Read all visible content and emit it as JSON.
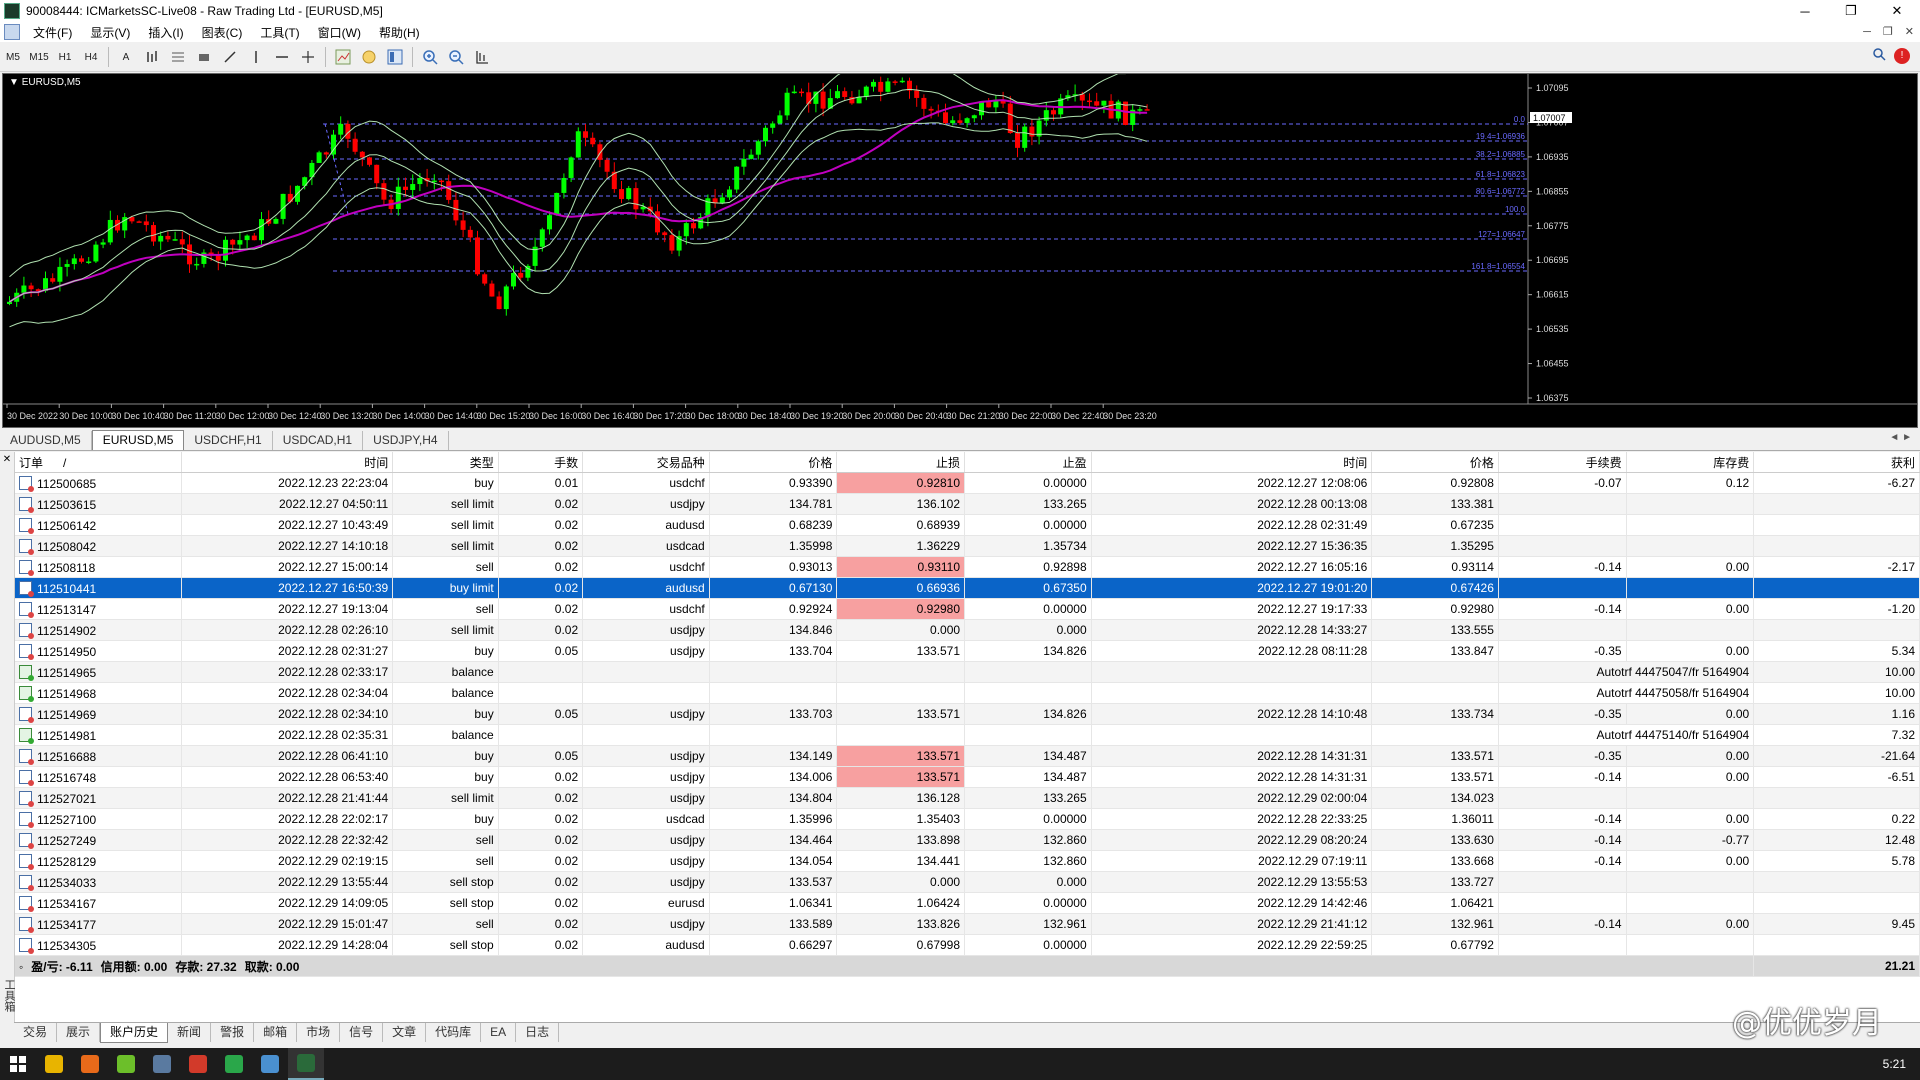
{
  "window": {
    "title": "90008444: ICMarketsSC-Live08 - Raw Trading Ltd - [EURUSD,M5]"
  },
  "menu": [
    "文件(F)",
    "显示(V)",
    "插入(I)",
    "图表(C)",
    "工具(T)",
    "窗口(W)",
    "帮助(H)"
  ],
  "toolbar": {
    "timeframes": [
      "M5",
      "M15",
      "H1",
      "H4"
    ],
    "tools": [
      "A"
    ]
  },
  "chart": {
    "label": "EURUSD,M5",
    "background": "#000000",
    "bull_color": "#00ff00",
    "bear_color": "#ff0000",
    "ma_color": "#c000c0",
    "fib_color": "#6a6aff",
    "price_labels": [
      "1.07095",
      "1.07007",
      "1.06935",
      "1.06855",
      "1.06775",
      "1.06695",
      "1.06615",
      "1.06535",
      "1.06455",
      "1.06375"
    ],
    "current_price": "1.07007",
    "fib_labels": [
      "0.0",
      "19.4=1.06936",
      "38.2=1.06885",
      "61.8=1.06823",
      "80.6=1.06772",
      "100.0",
      "127=1.06647",
      "161.8=1.06554"
    ],
    "time_labels": [
      "30 Dec 2022",
      "30 Dec 10:00",
      "30 Dec 10:40",
      "30 Dec 11:20",
      "30 Dec 12:00",
      "30 Dec 12:40",
      "30 Dec 13:20",
      "30 Dec 14:00",
      "30 Dec 14:40",
      "30 Dec 15:20",
      "30 Dec 16:00",
      "30 Dec 16:40",
      "30 Dec 17:20",
      "30 Dec 18:00",
      "30 Dec 18:40",
      "30 Dec 19:20",
      "30 Dec 20:00",
      "30 Dec 20:40",
      "30 Dec 21:20",
      "30 Dec 22:00",
      "30 Dec 22:40",
      "30 Dec 23:20"
    ]
  },
  "chart_tabs": [
    "AUDUSD,M5",
    "EURUSD,M5",
    "USDCHF,H1",
    "USDCAD,H1",
    "USDJPY,H4"
  ],
  "active_chart_tab": 1,
  "table": {
    "headers": [
      "订单",
      "时间",
      "类型",
      "手数",
      "交易品种",
      "价格",
      "止损",
      "止盈",
      "时间",
      "价格",
      "手续费",
      "库存费",
      "获利"
    ],
    "sort_marker": "/",
    "rows": [
      {
        "icon": "order",
        "cells": [
          "112500685",
          "2022.12.23 22:23:04",
          "buy",
          "0.01",
          "usdchf",
          "0.93390",
          "0.92810",
          "0.00000",
          "2022.12.27 12:08:06",
          "0.92808",
          "-0.07",
          "0.12",
          "-6.27"
        ],
        "sl_hit": true
      },
      {
        "icon": "order",
        "cells": [
          "112503615",
          "2022.12.27 04:50:11",
          "sell limit",
          "0.02",
          "usdjpy",
          "134.781",
          "136.102",
          "133.265",
          "2022.12.28 00:13:08",
          "133.381",
          "",
          "",
          ""
        ]
      },
      {
        "icon": "order",
        "cells": [
          "112506142",
          "2022.12.27 10:43:49",
          "sell limit",
          "0.02",
          "audusd",
          "0.68239",
          "0.68939",
          "0.00000",
          "2022.12.28 02:31:49",
          "0.67235",
          "",
          "",
          ""
        ]
      },
      {
        "icon": "order",
        "cells": [
          "112508042",
          "2022.12.27 14:10:18",
          "sell limit",
          "0.02",
          "usdcad",
          "1.35998",
          "1.36229",
          "1.35734",
          "2022.12.27 15:36:35",
          "1.35295",
          "",
          "",
          ""
        ]
      },
      {
        "icon": "order",
        "cells": [
          "112508118",
          "2022.12.27 15:00:14",
          "sell",
          "0.02",
          "usdchf",
          "0.93013",
          "0.93110",
          "0.92898",
          "2022.12.27 16:05:16",
          "0.93114",
          "-0.14",
          "0.00",
          "-2.17"
        ],
        "sl_hit": true
      },
      {
        "icon": "order",
        "cells": [
          "112510441",
          "2022.12.27 16:50:39",
          "buy limit",
          "0.02",
          "audusd",
          "0.67130",
          "0.66936",
          "0.67350",
          "2022.12.27 19:01:20",
          "0.67426",
          "",
          "",
          ""
        ],
        "selected": true
      },
      {
        "icon": "order",
        "cells": [
          "112513147",
          "2022.12.27 19:13:04",
          "sell",
          "0.02",
          "usdchf",
          "0.92924",
          "0.92980",
          "0.00000",
          "2022.12.27 19:17:33",
          "0.92980",
          "-0.14",
          "0.00",
          "-1.20"
        ],
        "sl_hit": true
      },
      {
        "icon": "order",
        "cells": [
          "112514902",
          "2022.12.28 02:26:10",
          "sell limit",
          "0.02",
          "usdjpy",
          "134.846",
          "0.000",
          "0.000",
          "2022.12.28 14:33:27",
          "133.555",
          "",
          "",
          ""
        ]
      },
      {
        "icon": "order",
        "cells": [
          "112514950",
          "2022.12.28 02:31:27",
          "buy",
          "0.05",
          "usdjpy",
          "133.704",
          "133.571",
          "134.826",
          "2022.12.28 08:11:28",
          "133.847",
          "-0.35",
          "0.00",
          "5.34"
        ]
      },
      {
        "icon": "balance",
        "cells": [
          "112514965",
          "2022.12.28 02:33:17",
          "balance",
          "",
          "",
          "",
          "",
          "",
          "",
          "",
          "Autotrf 44475047/fr 5164904",
          "",
          "10.00"
        ],
        "balance": true
      },
      {
        "icon": "balance",
        "cells": [
          "112514968",
          "2022.12.28 02:34:04",
          "balance",
          "",
          "",
          "",
          "",
          "",
          "",
          "",
          "Autotrf 44475058/fr 5164904",
          "",
          "10.00"
        ],
        "balance": true
      },
      {
        "icon": "order",
        "cells": [
          "112514969",
          "2022.12.28 02:34:10",
          "buy",
          "0.05",
          "usdjpy",
          "133.703",
          "133.571",
          "134.826",
          "2022.12.28 14:10:48",
          "133.734",
          "-0.35",
          "0.00",
          "1.16"
        ]
      },
      {
        "icon": "balance",
        "cells": [
          "112514981",
          "2022.12.28 02:35:31",
          "balance",
          "",
          "",
          "",
          "",
          "",
          "",
          "",
          "Autotrf 44475140/fr 5164904",
          "",
          "7.32"
        ],
        "balance": true
      },
      {
        "icon": "order",
        "cells": [
          "112516688",
          "2022.12.28 06:41:10",
          "buy",
          "0.05",
          "usdjpy",
          "134.149",
          "133.571",
          "134.487",
          "2022.12.28 14:31:31",
          "133.571",
          "-0.35",
          "0.00",
          "-21.64"
        ],
        "sl_hit": true
      },
      {
        "icon": "order",
        "cells": [
          "112516748",
          "2022.12.28 06:53:40",
          "buy",
          "0.02",
          "usdjpy",
          "134.006",
          "133.571",
          "134.487",
          "2022.12.28 14:31:31",
          "133.571",
          "-0.14",
          "0.00",
          "-6.51"
        ],
        "sl_hit": true
      },
      {
        "icon": "order",
        "cells": [
          "112527021",
          "2022.12.28 21:41:44",
          "sell limit",
          "0.02",
          "usdjpy",
          "134.804",
          "136.128",
          "133.265",
          "2022.12.29 02:00:04",
          "134.023",
          "",
          "",
          ""
        ]
      },
      {
        "icon": "order",
        "cells": [
          "112527100",
          "2022.12.28 22:02:17",
          "buy",
          "0.02",
          "usdcad",
          "1.35996",
          "1.35403",
          "0.00000",
          "2022.12.28 22:33:25",
          "1.36011",
          "-0.14",
          "0.00",
          "0.22"
        ]
      },
      {
        "icon": "order",
        "cells": [
          "112527249",
          "2022.12.28 22:32:42",
          "sell",
          "0.02",
          "usdjpy",
          "134.464",
          "133.898",
          "132.860",
          "2022.12.29 08:20:24",
          "133.630",
          "-0.14",
          "-0.77",
          "12.48"
        ]
      },
      {
        "icon": "order",
        "cells": [
          "112528129",
          "2022.12.29 02:19:15",
          "sell",
          "0.02",
          "usdjpy",
          "134.054",
          "134.441",
          "132.860",
          "2022.12.29 07:19:11",
          "133.668",
          "-0.14",
          "0.00",
          "5.78"
        ]
      },
      {
        "icon": "order",
        "cells": [
          "112534033",
          "2022.12.29 13:55:44",
          "sell stop",
          "0.02",
          "usdjpy",
          "133.537",
          "0.000",
          "0.000",
          "2022.12.29 13:55:53",
          "133.727",
          "",
          "",
          ""
        ]
      },
      {
        "icon": "order",
        "cells": [
          "112534167",
          "2022.12.29 14:09:05",
          "sell stop",
          "0.02",
          "eurusd",
          "1.06341",
          "1.06424",
          "0.00000",
          "2022.12.29 14:42:46",
          "1.06421",
          "",
          "",
          ""
        ]
      },
      {
        "icon": "order",
        "cells": [
          "112534177",
          "2022.12.29 15:01:47",
          "sell",
          "0.02",
          "usdjpy",
          "133.589",
          "133.826",
          "132.961",
          "2022.12.29 21:41:12",
          "132.961",
          "-0.14",
          "0.00",
          "9.45"
        ]
      },
      {
        "icon": "order",
        "cells": [
          "112534305",
          "2022.12.29 14:28:04",
          "sell stop",
          "0.02",
          "audusd",
          "0.66297",
          "0.67998",
          "0.00000",
          "2022.12.29 22:59:25",
          "0.67792",
          "",
          "",
          ""
        ]
      }
    ],
    "summary": {
      "icon": "◦",
      "profit_label": "盈/亏: -6.11",
      "credit_label": "信用额: 0.00",
      "deposit_label": "存款: 27.32",
      "withdraw_label": "取款: 0.00",
      "total": "21.21"
    }
  },
  "terminal_side_label": "工具箱",
  "bottom_tabs": [
    "交易",
    "展示",
    "账户历史",
    "新闻",
    "警报",
    "邮箱",
    "市场",
    "信号",
    "文章",
    "代码库",
    "EA",
    "日志"
  ],
  "active_bottom_tab": 2,
  "watermark": "@优优岁月",
  "taskbar": {
    "clock": "5:21",
    "icons": [
      "windows-start-icon",
      "chrome-icon",
      "search-app-icon",
      "green-app-icon",
      "app-icon",
      "red-app-icon",
      "wechat-icon",
      "app2-icon",
      "mt4-icon"
    ]
  }
}
